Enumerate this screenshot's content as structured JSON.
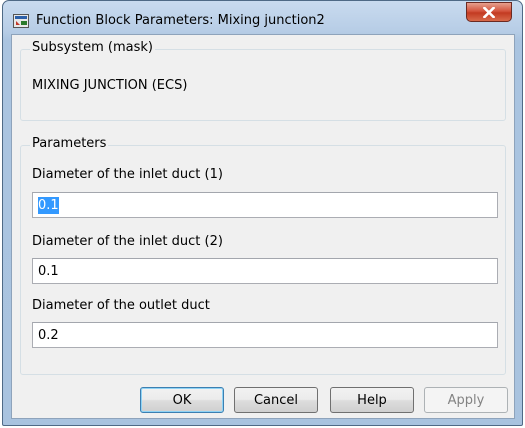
{
  "window": {
    "title": "Function Block Parameters: Mixing junction2"
  },
  "mask_section": {
    "label": "Subsystem (mask)",
    "description": "MIXING JUNCTION (ECS)"
  },
  "parameters_section": {
    "label": "Parameters",
    "fields": [
      {
        "label": "Diameter of the inlet duct (1)",
        "value": "0.1",
        "selected": true
      },
      {
        "label": "Diameter of the inlet duct (2)",
        "value": "0.1",
        "selected": false
      },
      {
        "label": "Diameter of the outlet duct",
        "value": "0.2",
        "selected": false
      }
    ]
  },
  "buttons": {
    "ok": "OK",
    "cancel": "Cancel",
    "help": "Help",
    "apply": "Apply"
  },
  "colors": {
    "selection": "#3399ff",
    "close_button": "#c33a22",
    "title_bar": "#b7cde6"
  }
}
